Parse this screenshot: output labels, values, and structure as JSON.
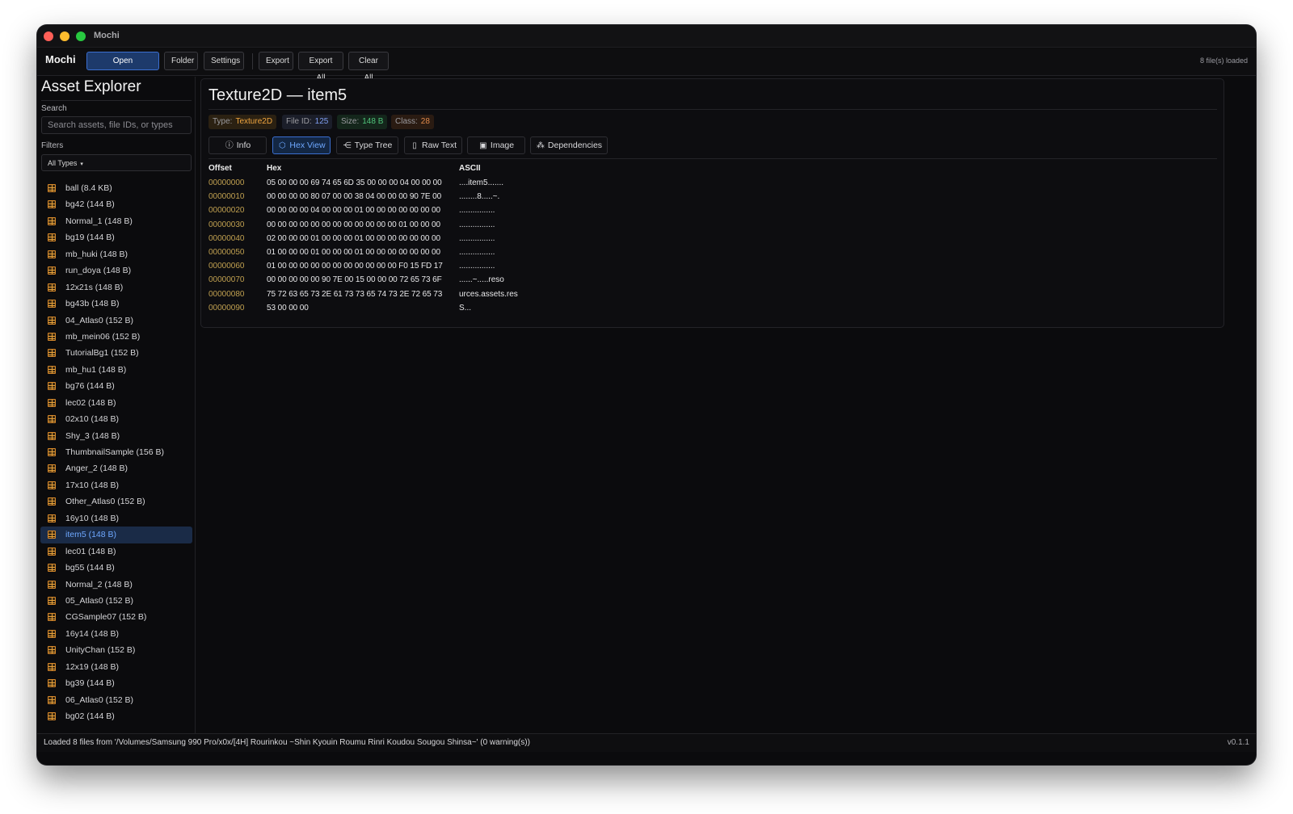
{
  "window": {
    "title": "Mochi"
  },
  "toolbar": {
    "brand": "Mochi",
    "open": "Open",
    "folder": "Folder",
    "settings": "Settings",
    "export": "Export",
    "export_all": "Export All",
    "clear_all": "Clear All",
    "files_loaded": "8 file(s) loaded"
  },
  "sidebar": {
    "title": "Asset Explorer",
    "search_label": "Search",
    "search_placeholder": "Search assets, file IDs, or types",
    "filters_label": "Filters",
    "filter_value": "All Types",
    "items": [
      "ball (8.4 KB)",
      "bg42 (144 B)",
      "Normal_1 (148 B)",
      "bg19 (144 B)",
      "mb_huki (148 B)",
      "run_doya (148 B)",
      "12x21s (148 B)",
      "bg43b (148 B)",
      "04_Atlas0 (152 B)",
      "mb_mein06 (152 B)",
      "TutorialBg1 (152 B)",
      "mb_hu1 (148 B)",
      "bg76 (144 B)",
      "lec02 (148 B)",
      "02x10 (148 B)",
      "Shy_3 (148 B)",
      "ThumbnailSample (156 B)",
      "Anger_2 (148 B)",
      "17x10 (148 B)",
      "Other_Atlas0 (152 B)",
      "16y10 (148 B)",
      "item5 (148 B)",
      "lec01 (148 B)",
      "bg55 (144 B)",
      "Normal_2 (148 B)",
      "05_Atlas0 (152 B)",
      "CGSample07 (152 B)",
      "16y14 (148 B)",
      "UnityChan (152 B)",
      "12x19 (148 B)",
      "bg39 (144 B)",
      "06_Atlas0 (152 B)",
      "bg02 (144 B)"
    ],
    "selected_index": 21
  },
  "detail": {
    "title": "Texture2D — item5",
    "badges": {
      "type_key": "Type:",
      "type_val": "Texture2D",
      "fid_key": "File ID:",
      "fid_val": "125",
      "size_key": "Size:",
      "size_val": "148 B",
      "class_key": "Class:",
      "class_val": "28"
    },
    "tabs": [
      {
        "label": "Info",
        "icon": "info-icon"
      },
      {
        "label": "Hex View",
        "icon": "hex-icon"
      },
      {
        "label": "Type Tree",
        "icon": "tree-icon"
      },
      {
        "label": "Raw Text",
        "icon": "file-text-icon"
      },
      {
        "label": "Image",
        "icon": "image-icon"
      },
      {
        "label": "Dependencies",
        "icon": "dependencies-icon"
      }
    ],
    "active_tab": "Hex View",
    "hex": {
      "headers": {
        "offset": "Offset",
        "hex": "Hex",
        "ascii": "ASCII"
      },
      "rows": [
        {
          "offset": "00000000",
          "hex": "05 00 00 00 69 74 65 6D 35 00 00 00 04 00 00 00",
          "ascii": "....item5......."
        },
        {
          "offset": "00000010",
          "hex": "00 00 00 00 80 07 00 00 38 04 00 00 00 90 7E 00",
          "ascii": "........8.....~."
        },
        {
          "offset": "00000020",
          "hex": "00 00 00 00 04 00 00 00 01 00 00 00 00 00 00 00",
          "ascii": "................"
        },
        {
          "offset": "00000030",
          "hex": "00 00 00 00 00 00 00 00 00 00 00 00 01 00 00 00",
          "ascii": "................"
        },
        {
          "offset": "00000040",
          "hex": "02 00 00 00 01 00 00 00 01 00 00 00 00 00 00 00",
          "ascii": "................"
        },
        {
          "offset": "00000050",
          "hex": "01 00 00 00 01 00 00 00 01 00 00 00 00 00 00 00",
          "ascii": "................"
        },
        {
          "offset": "00000060",
          "hex": "01 00 00 00 00 00 00 00 00 00 00 00 F0 15 FD 17",
          "ascii": "................"
        },
        {
          "offset": "00000070",
          "hex": "00 00 00 00 00 90 7E 00 15 00 00 00 72 65 73 6F",
          "ascii": "......~.....reso"
        },
        {
          "offset": "00000080",
          "hex": "75 72 63 65 73 2E 61 73 73 65 74 73 2E 72 65 73",
          "ascii": "urces.assets.res"
        },
        {
          "offset": "00000090",
          "hex": "53 00 00 00",
          "ascii": "S..."
        }
      ]
    }
  },
  "status": {
    "message": "Loaded 8 files from '/Volumes/Samsung 990 Pro/x0x/[4H] Rourinkou ~Shin Kyouin Roumu Rinri Koudou Sougou Shinsa~' (0 warning(s))",
    "version": "v0.1.1"
  },
  "colors": {
    "accent": "#3b6fd0",
    "selected_text": "#6ea8ff",
    "offset_text": "#c0a050",
    "type_badge": "#f0a640",
    "fileid_badge": "#7f9ef0",
    "size_badge": "#4fc47a",
    "class_badge": "#e0894a"
  }
}
